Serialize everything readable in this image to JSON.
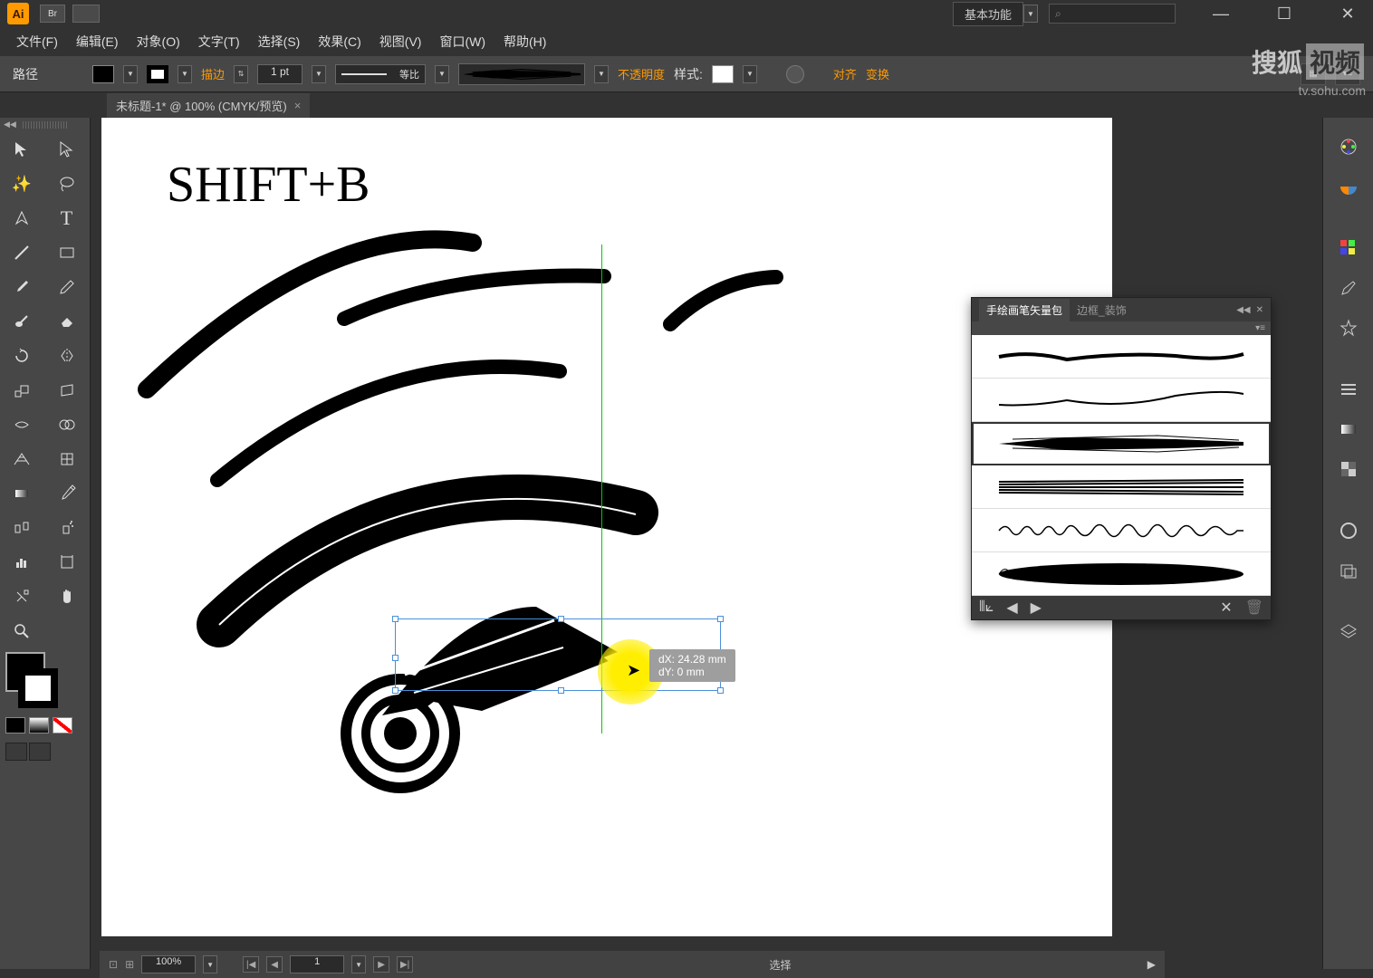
{
  "app": {
    "logo": "Ai",
    "bridge_icon": "Br"
  },
  "workspace": {
    "label": "基本功能",
    "search_placeholder": "⌕"
  },
  "menu": {
    "file": "文件(F)",
    "edit": "编辑(E)",
    "object": "对象(O)",
    "type": "文字(T)",
    "select": "选择(S)",
    "effect": "效果(C)",
    "view": "视图(V)",
    "window": "窗口(W)",
    "help": "帮助(H)"
  },
  "control": {
    "path_label": "路径",
    "stroke_label": "描边",
    "stroke_weight": "1 pt",
    "profile_label": "等比",
    "opacity_label": "不透明度",
    "style_label": "样式:",
    "align_label": "对齐",
    "transform_label": "变换"
  },
  "doc_tab": {
    "title": "未标题-1* @ 100% (CMYK/预览)"
  },
  "canvas": {
    "shortcut_text": "SHIFT+B",
    "measure_dx": "dX: 24.28 mm",
    "measure_dy": "dY: 0 mm"
  },
  "brush_panel": {
    "tab1": "手绘画笔矢量包",
    "tab2": "边框_装饰"
  },
  "status": {
    "zoom": "100%",
    "page": "1",
    "tool_label": "选择"
  },
  "watermark": {
    "t1": "搜狐",
    "t2": "视频",
    "url": "tv.sohu.com"
  }
}
